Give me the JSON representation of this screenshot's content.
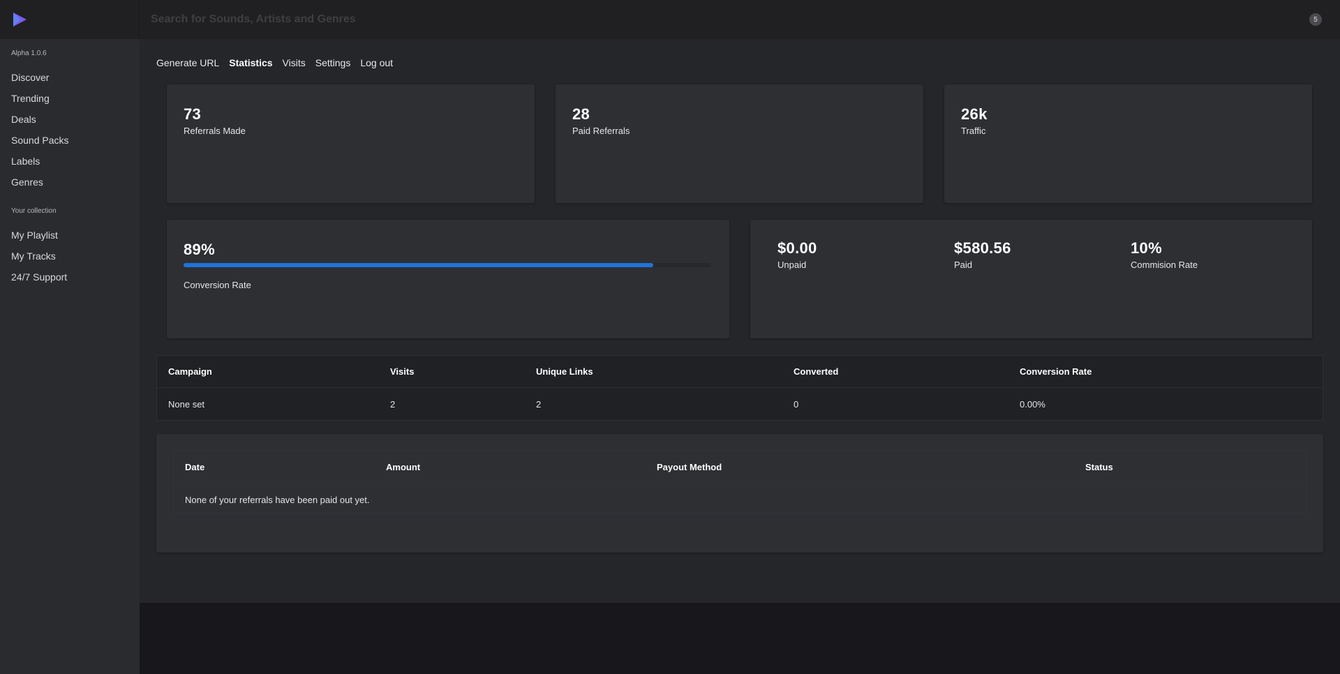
{
  "app": {
    "version": "Alpha 1.0.6",
    "brand_color": "#7b5cf0",
    "accent_color": "#1f73d9"
  },
  "search": {
    "placeholder": "Search for Sounds, Artists and Genres",
    "value": ""
  },
  "notifications": {
    "count": "5"
  },
  "sidebar": {
    "items": [
      {
        "label": "Discover"
      },
      {
        "label": "Trending"
      },
      {
        "label": "Deals"
      },
      {
        "label": "Sound Packs"
      },
      {
        "label": "Labels"
      },
      {
        "label": "Genres"
      }
    ],
    "collection_label": "Your collection",
    "collection_items": [
      {
        "label": "My Playlist"
      },
      {
        "label": "My Tracks"
      },
      {
        "label": "24/7 Support"
      }
    ]
  },
  "tabs": [
    {
      "label": "Generate URL",
      "active": false
    },
    {
      "label": "Statistics",
      "active": true
    },
    {
      "label": "Visits",
      "active": false
    },
    {
      "label": "Settings",
      "active": false
    },
    {
      "label": "Log out",
      "active": false
    }
  ],
  "stats": {
    "referrals": {
      "value": "73",
      "label": "Referrals Made"
    },
    "paid_referrals": {
      "value": "28",
      "label": "Paid Referrals"
    },
    "traffic": {
      "value": "26k",
      "label": "Traffic"
    },
    "conversion": {
      "value": "89%",
      "label": "Conversion Rate",
      "progress_fraction": 0.89
    },
    "unpaid": {
      "value": "$0.00",
      "label": "Unpaid"
    },
    "paid": {
      "value": "$580.56",
      "label": "Paid"
    },
    "commission": {
      "value": "10%",
      "label": "Commision Rate"
    }
  },
  "campaigns": {
    "headers": [
      "Campaign",
      "Visits",
      "Unique Links",
      "Converted",
      "Conversion Rate"
    ],
    "rows": [
      [
        "None set",
        "2",
        "2",
        "0",
        "0.00%"
      ]
    ]
  },
  "payouts": {
    "headers": [
      "Date",
      "Amount",
      "Payout Method",
      "Status"
    ],
    "empty_message": "None of your referrals have been paid out yet."
  }
}
